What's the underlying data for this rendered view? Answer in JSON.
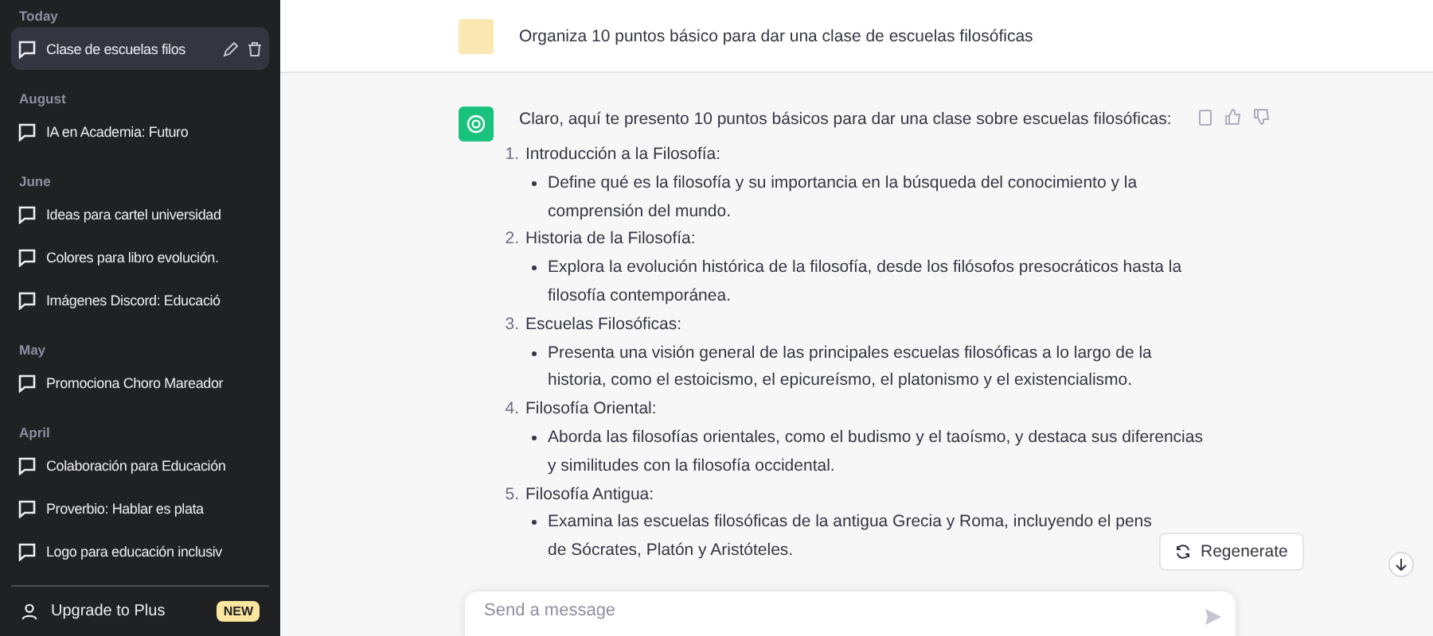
{
  "sidebar": {
    "groups": [
      {
        "heading": "Today",
        "items": [
          {
            "title": "Clase de escuelas filos",
            "selected": true
          }
        ]
      },
      {
        "heading": "August",
        "items": [
          {
            "title": "IA en Academia: Futuro",
            "selected": false
          }
        ]
      },
      {
        "heading": "June",
        "items": [
          {
            "title": "Ideas para cartel universidad",
            "selected": false
          },
          {
            "title": "Colores para libro evolución.",
            "selected": false
          },
          {
            "title": "Imágenes Discord: Educació",
            "selected": false
          }
        ]
      },
      {
        "heading": "May",
        "items": [
          {
            "title": "Promociona Choro Mareador",
            "selected": false
          }
        ]
      },
      {
        "heading": "April",
        "items": [
          {
            "title": "Colaboración para Educación",
            "selected": false
          },
          {
            "title": "Proverbio: Hablar es plata",
            "selected": false
          },
          {
            "title": "Logo para educación inclusiv",
            "selected": false
          }
        ]
      }
    ],
    "footer": {
      "label": "Upgrade to Plus",
      "badge": "NEW"
    }
  },
  "user_message": {
    "text": "Organiza 10 puntos básico para dar una clase de escuelas filosóficas"
  },
  "assistant_message": {
    "intro": "Claro, aquí te presento 10 puntos básicos para dar una clase sobre escuelas filosóficas:",
    "points": [
      {
        "number": "1.",
        "title": "Introducción a la Filosofía:",
        "bullet": [
          "Define qué es la filosofía y su importancia en la búsqueda del conocimiento y la",
          "comprensión del mundo."
        ]
      },
      {
        "number": "2.",
        "title": "Historia de la Filosofía:",
        "bullet": [
          "Explora la evolución histórica de la filosofía, desde los filósofos presocráticos hasta la",
          "filosofía contemporánea."
        ]
      },
      {
        "number": "3.",
        "title": "Escuelas Filosóficas:",
        "bullet": [
          "Presenta una visión general de las principales escuelas filosóficas a lo largo de la",
          "historia, como el estoicismo, el epicureísmo, el platonismo y el existencialismo."
        ]
      },
      {
        "number": "4.",
        "title": "Filosofía Oriental:",
        "bullet": [
          "Aborda las filosofías orientales, como el budismo y el taoísmo, y destaca sus diferencias",
          "y similitudes con la filosofía occidental."
        ]
      },
      {
        "number": "5.",
        "title": "Filosofía Antigua:",
        "bullet": [
          "Examina las escuelas filosóficas de la antigua Grecia y Roma, incluyendo el pens",
          "de Sócrates, Platón y Aristóteles."
        ]
      }
    ]
  },
  "regenerate_button": {
    "label": "Regenerate"
  },
  "composer": {
    "placeholder": "Send a message"
  }
}
